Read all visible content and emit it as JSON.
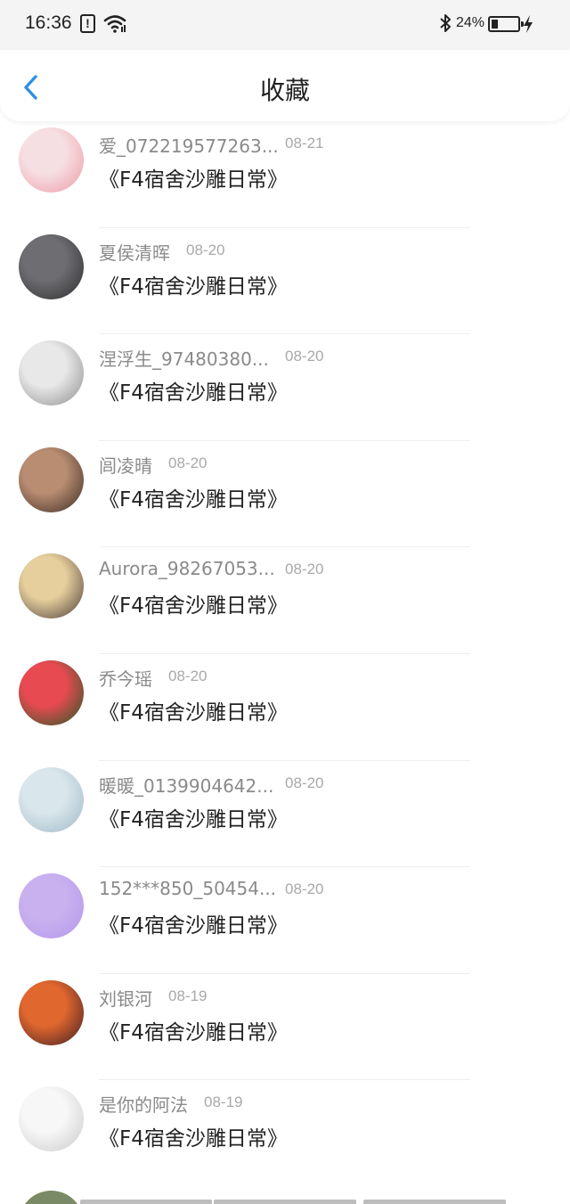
{
  "status_bar": {
    "time": "16:36",
    "alert_glyph": "!",
    "battery_text": "24%",
    "battery_level": 0.24
  },
  "header": {
    "title": "收藏"
  },
  "items": [
    {
      "name": "爱_072219577263...",
      "date": "08-21",
      "title": "《F4宿舍沙雕日常》",
      "avatar_colors": [
        "#f6dfe2",
        "#ec9aa6"
      ]
    },
    {
      "name": "夏侯清晖",
      "date": "08-20",
      "title": "《F4宿舍沙雕日常》",
      "avatar_colors": [
        "#6e6e72",
        "#2d2a2c"
      ]
    },
    {
      "name": "涅浮生_97480380...",
      "date": "08-20",
      "title": "《F4宿舍沙雕日常》",
      "avatar_colors": [
        "#e8e8e8",
        "#8c8c8c"
      ]
    },
    {
      "name": "闾凌晴",
      "date": "08-20",
      "title": "《F4宿舍沙雕日常》",
      "avatar_colors": [
        "#b98d72",
        "#3a2a22"
      ]
    },
    {
      "name": "Aurora_98267053...",
      "date": "08-20",
      "title": "《F4宿舍沙雕日常》",
      "avatar_colors": [
        "#e6cf9c",
        "#4a3a3a"
      ]
    },
    {
      "name": "乔今瑶",
      "date": "08-20",
      "title": "《F4宿舍沙雕日常》",
      "avatar_colors": [
        "#e84a52",
        "#1f5a22"
      ]
    },
    {
      "name": "暖暖_0139904642...",
      "date": "08-20",
      "title": "《F4宿舍沙雕日常》",
      "avatar_colors": [
        "#d9e6ec",
        "#9fb8c6"
      ]
    },
    {
      "name": "152***850_50454...",
      "date": "08-20",
      "title": "《F4宿舍沙雕日常》",
      "avatar_colors": [
        "#c9b1ef",
        "#b497ea"
      ]
    },
    {
      "name": "刘银河",
      "date": "08-19",
      "title": "《F4宿舍沙雕日常》",
      "avatar_colors": [
        "#e0672e",
        "#3a1c24"
      ]
    },
    {
      "name": "是你的阿法",
      "date": "08-19",
      "title": "《F4宿舍沙雕日常》",
      "avatar_colors": [
        "#f7f7f7",
        "#c9c9c9"
      ]
    }
  ]
}
